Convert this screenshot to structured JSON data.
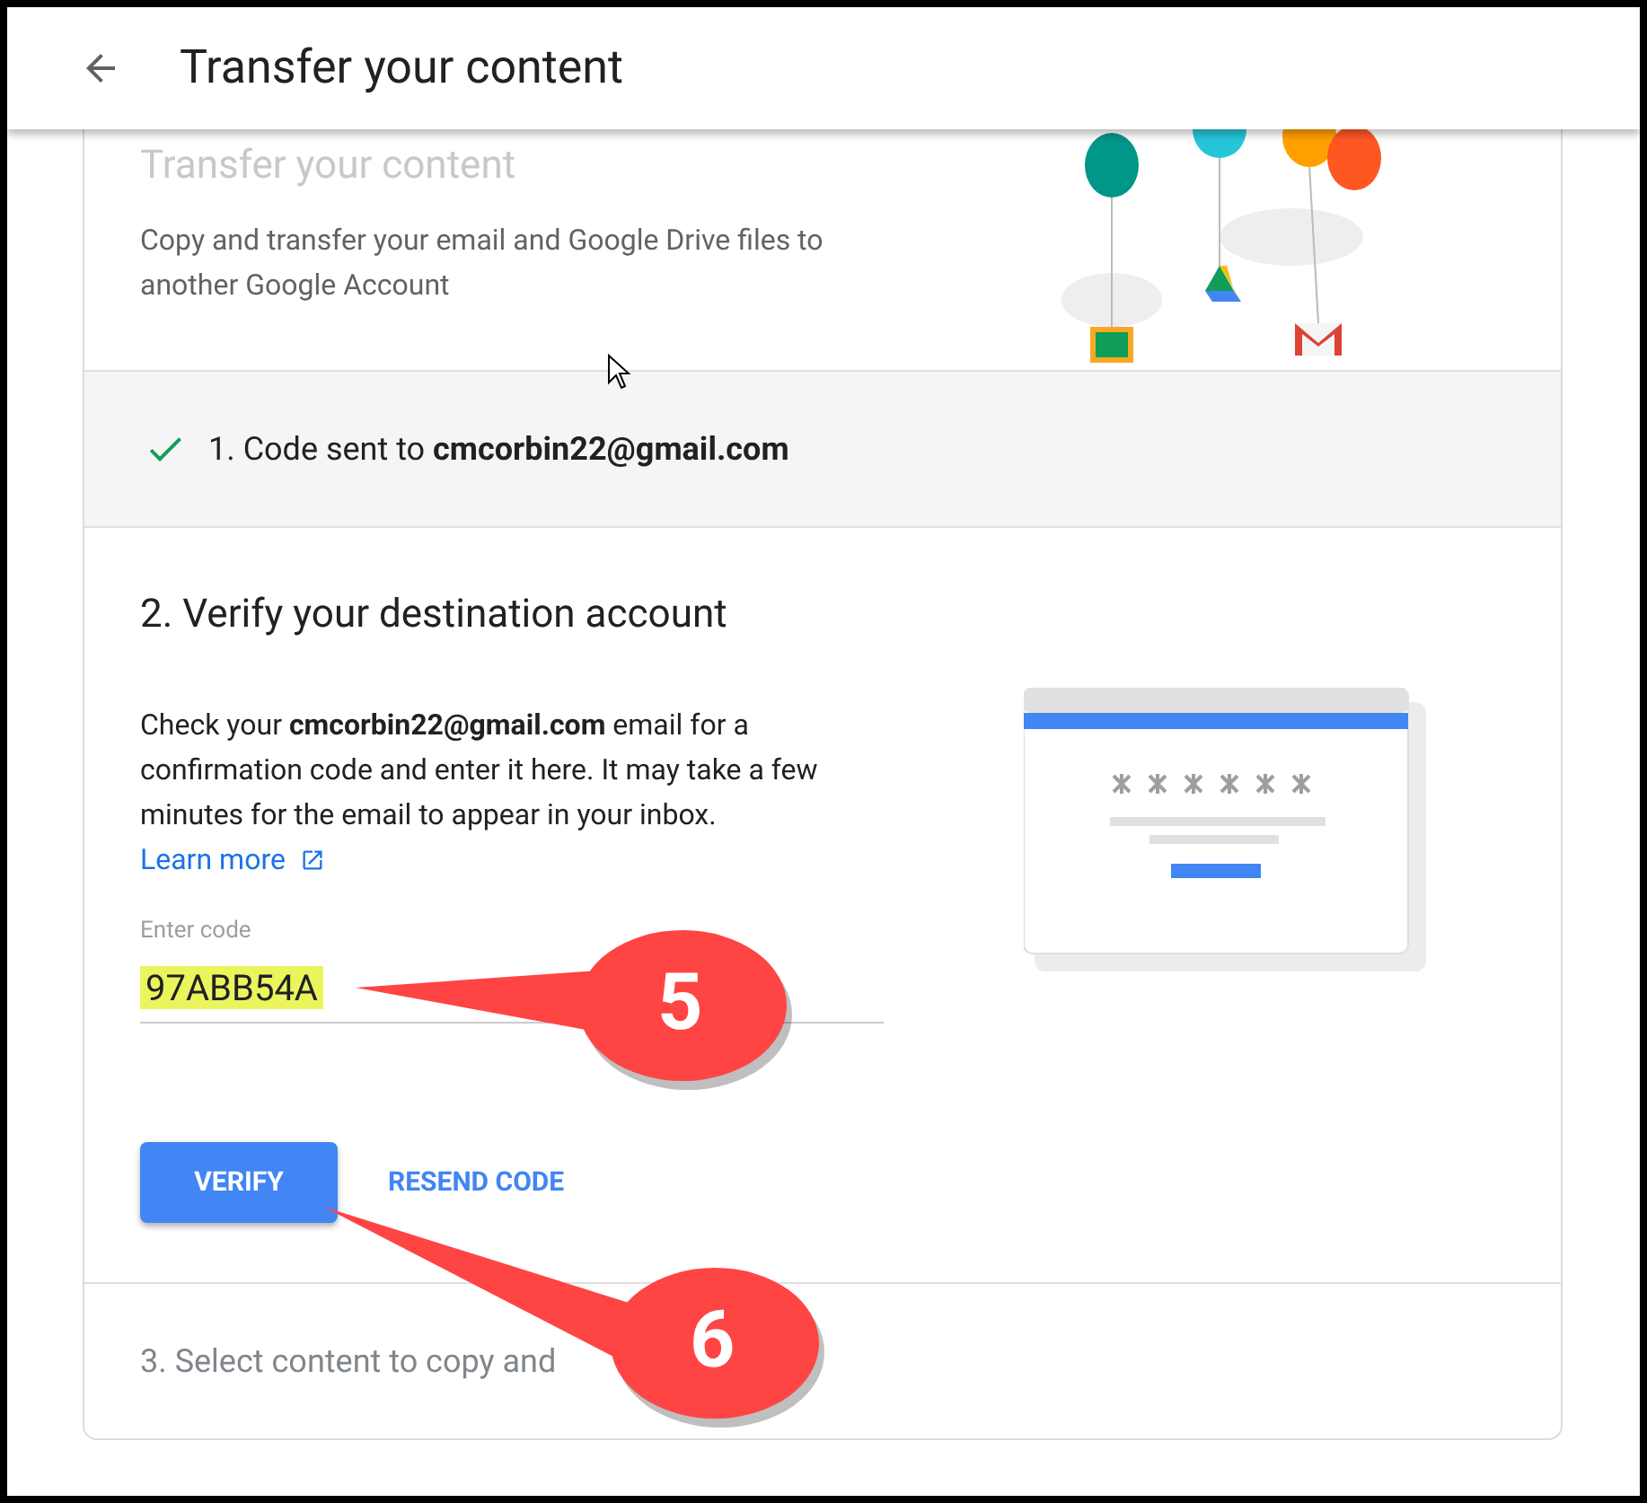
{
  "header": {
    "title": "Transfer your content"
  },
  "intro": {
    "title": "Transfer your content",
    "description": "Copy and transfer your email and Google Drive files to another Google Account"
  },
  "step1": {
    "text": "1. Code sent to **cmcorbin22@gmail.com**",
    "done": true
  },
  "step2": {
    "title": "2. Verify your destination account",
    "paragraph": "Check your **cmcorbin22@gmail.com** email for a confirmation code and enter it here. It may take a few minutes for the email to appear in your inbox.",
    "link": "Learn more",
    "field": {
      "label": "Enter code",
      "value": "97ABB54A",
      "highlighted": true
    },
    "primary_button": "VERIFY",
    "secondary_button": "RESEND CODE"
  },
  "step3": {
    "text": "3. Select content to copy and",
    "disabled": true
  },
  "callouts": [
    {
      "label": "5"
    },
    {
      "label": "6"
    }
  ]
}
